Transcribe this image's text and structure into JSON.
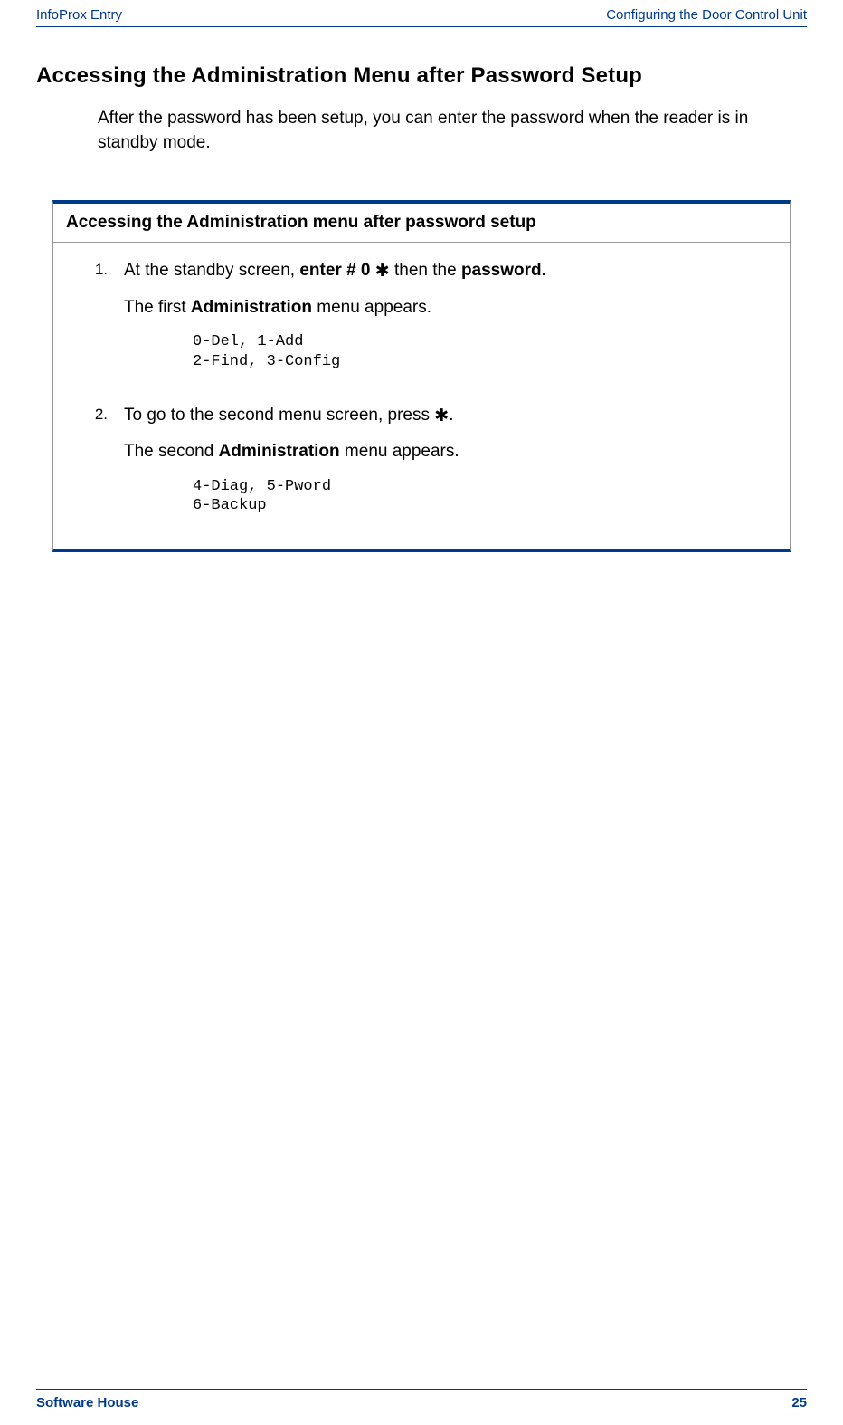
{
  "header": {
    "left": "InfoProx Entry",
    "right": "Configuring the Door Control Unit"
  },
  "title": "Accessing the Administration Menu after Password Setup",
  "intro": "After the password has been setup, you can enter the password when the reader is in standby mode.",
  "procedure": {
    "title": "Accessing the Administration menu after password setup",
    "steps": [
      {
        "num": "1.",
        "line1_pre": "At the standby screen, ",
        "line1_bold1": "enter # 0 ",
        "star": "✱",
        "line1_mid": " then the ",
        "line1_bold2": "password.",
        "line2_pre": "The first ",
        "line2_bold": "Administration",
        "line2_post": " menu appears.",
        "code": "0-Del, 1-Add\n2-Find, 3-Config"
      },
      {
        "num": "2.",
        "line1_pre": "To go to the second menu screen, press ",
        "star": "✱",
        "line1_post": ".",
        "line2_pre": "The second ",
        "line2_bold": "Administration",
        "line2_post": " menu appears.",
        "code": "4-Diag, 5-Pword\n6-Backup"
      }
    ]
  },
  "footer": {
    "left": "Software House",
    "right": "25"
  }
}
